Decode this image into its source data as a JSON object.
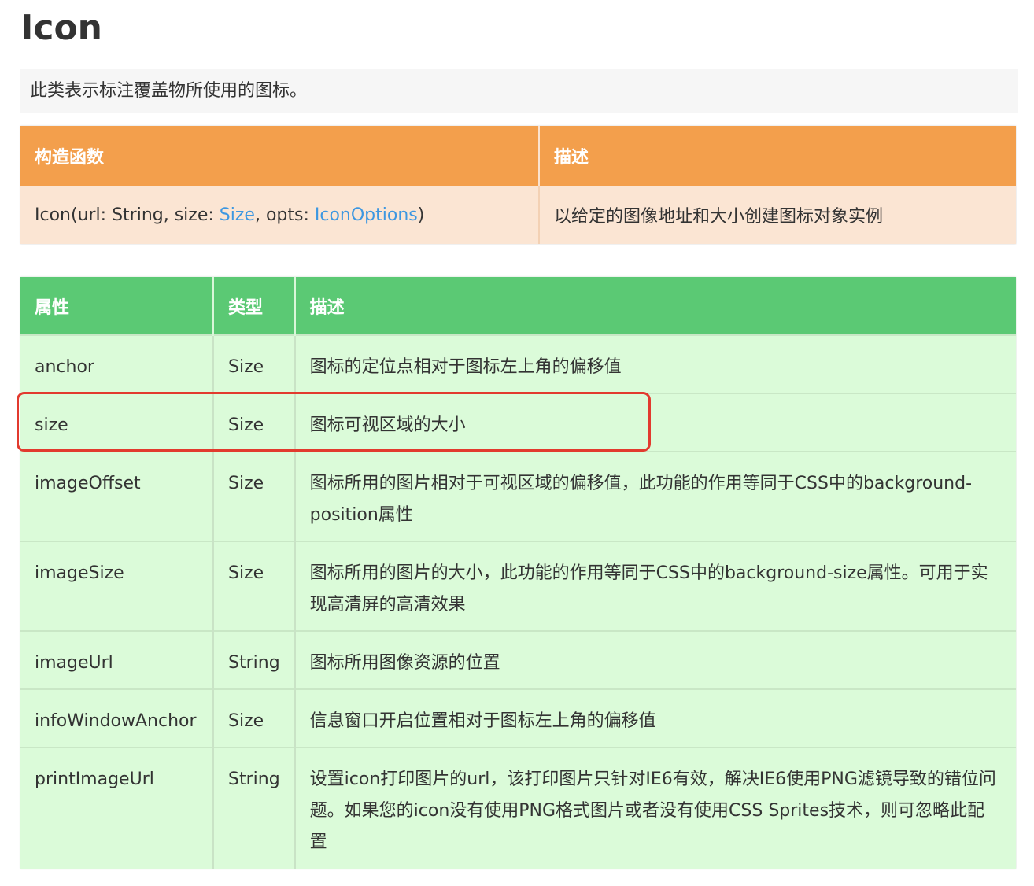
{
  "page": {
    "title": "Icon",
    "description": "此类表示标注覆盖物所使用的图标。"
  },
  "constructor_table": {
    "headers": [
      "构造函数",
      "描述"
    ],
    "signature": {
      "part1": "Icon(url: String, size: ",
      "size_link": "Size",
      "part2": ", opts: ",
      "options_link": "IconOptions",
      "part3": ")"
    },
    "description": "以给定的图像地址和大小创建图标对象实例"
  },
  "properties_table": {
    "headers": [
      "属性",
      "类型",
      "描述"
    ],
    "rows": [
      {
        "name": "anchor",
        "type": "Size",
        "type_is_link": true,
        "desc": "图标的定位点相对于图标左上角的偏移值"
      },
      {
        "name": "size",
        "type": "Size",
        "type_is_link": true,
        "desc": "图标可视区域的大小"
      },
      {
        "name": "imageOffset",
        "type": "Size",
        "type_is_link": true,
        "desc": "图标所用的图片相对于可视区域的偏移值，此功能的作用等同于CSS中的background-position属性"
      },
      {
        "name": "imageSize",
        "type": "Size",
        "type_is_link": true,
        "desc": "图标所用的图片的大小，此功能的作用等同于CSS中的background-size属性。可用于实现高清屏的高清效果"
      },
      {
        "name": "imageUrl",
        "type": "String",
        "type_is_link": false,
        "desc": "图标所用图像资源的位置"
      },
      {
        "name": "infoWindowAnchor",
        "type": "Size",
        "type_is_link": true,
        "desc": "信息窗口开启位置相对于图标左上角的偏移值"
      },
      {
        "name": "printImageUrl",
        "type": "String",
        "type_is_link": false,
        "desc": "设置icon打印图片的url，该打印图片只针对IE6有效，解决IE6使用PNG滤镜导致的错位问题。如果您的icon没有使用PNG格式图片或者没有使用CSS Sprites技术，则可忽略此配置"
      }
    ]
  },
  "colors": {
    "constructor_header": "#f39f4c",
    "constructor_row": "#fbe5d3",
    "properties_header": "#5bc974",
    "properties_row": "#dbfbd9",
    "link": "#3d97e1",
    "highlight_border": "#e23a2e"
  }
}
